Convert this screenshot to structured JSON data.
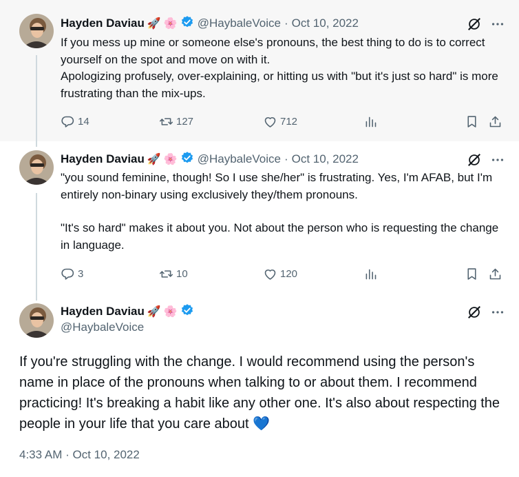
{
  "tweets": [
    {
      "name": "Hayden Daviau",
      "emoji": [
        "🚀",
        "🌸"
      ],
      "handle": "@HaybaleVoice",
      "date": "Oct 10, 2022",
      "text": [
        "If you mess up mine or someone else's pronouns, the best thing to do is to correct yourself on the spot and move on with it.",
        "Apologizing profusely, over-explaining, or hitting us with \"but it's just so hard\" is more frustrating than the mix-ups."
      ],
      "replies": "14",
      "reposts": "127",
      "likes": "712"
    },
    {
      "name": "Hayden Daviau",
      "emoji": [
        "🚀",
        "🌸"
      ],
      "handle": "@HaybaleVoice",
      "date": "Oct 10, 2022",
      "text": [
        "\"you sound feminine, though! So I use she/her\" is frustrating. Yes, I'm AFAB, but I'm entirely non-binary using exclusively they/them pronouns.",
        "\"It's so hard\" makes it about you. Not about the person who is requesting the change in language."
      ],
      "replies": "3",
      "reposts": "10",
      "likes": "120"
    },
    {
      "name": "Hayden Daviau",
      "emoji": [
        "🚀",
        "🌸"
      ],
      "handle": "@HaybaleVoice",
      "text": "If you're struggling with the change. I would recommend using the person's name in place of the pronouns when talking to or about them. I recommend practicing! It's breaking a habit like any other one. It's also about respecting the people in your life that you care about 💙",
      "time": "4:33 AM",
      "date": "Oct 10, 2022"
    }
  ],
  "colors": {
    "verified": "#1d9bf0",
    "muted": "#536471",
    "text": "#0f1419",
    "thread_line": "#cfd9de",
    "highlight_bg": "#f7f7f7"
  },
  "icons": {
    "reply": "reply-icon",
    "repost": "repost-icon",
    "like": "heart-icon",
    "views": "analytics-icon",
    "bookmark": "bookmark-icon",
    "share": "share-icon",
    "grok": "grok-icon",
    "more": "more-icon",
    "verified": "verified-badge-icon"
  }
}
